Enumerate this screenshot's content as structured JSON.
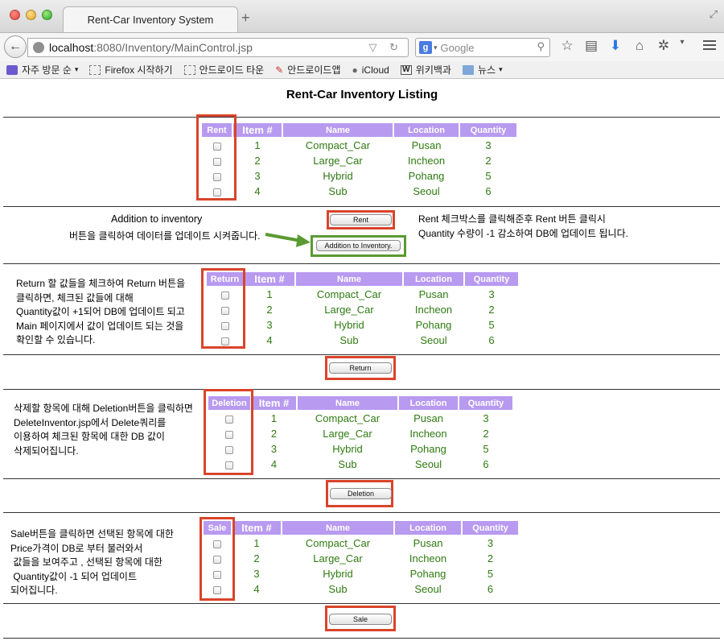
{
  "browser": {
    "tab_title": "Rent-Car Inventory System",
    "new_tab": "+",
    "url_host": "localhost",
    "url_path": ":8080/Inventory/MainControl.jsp",
    "search_placeholder": "Google",
    "search_engine_letter": "g",
    "bookmarks": [
      {
        "label": "자주 방문 순",
        "icon": "purple"
      },
      {
        "label": "Firefox 시작하기",
        "icon": "dashed"
      },
      {
        "label": "안드로이드 타운",
        "icon": "dashed"
      },
      {
        "label": "안드로이드앱",
        "icon": "pin"
      },
      {
        "label": "iCloud",
        "icon": "apple"
      },
      {
        "label": "위키백과",
        "icon": "w"
      },
      {
        "label": "뉴스",
        "icon": "folder"
      }
    ]
  },
  "page": {
    "title": "Rent-Car Inventory Listing",
    "columns": {
      "item": "Item #",
      "name": "Name",
      "location": "Location",
      "quantity": "Quantity"
    },
    "rows": [
      {
        "item": "1",
        "name": "Compact_Car",
        "location": "Pusan",
        "quantity": "3"
      },
      {
        "item": "2",
        "name": "Large_Car",
        "location": "Incheon",
        "quantity": "2"
      },
      {
        "item": "3",
        "name": "Hybrid",
        "location": "Pohang",
        "quantity": "5"
      },
      {
        "item": "4",
        "name": "Sub",
        "location": "Seoul",
        "quantity": "6"
      }
    ],
    "rent": {
      "header": "Rent",
      "button": "Rent",
      "addition_title": "Addition to inventory",
      "addition_desc": "버튼을 클릭하여 데이터를 업데이트 시켜줍니다.",
      "addition_button": "Addition to Inventory.",
      "note_lines": [
        "Rent 체크박스를 클릭해준후 Rent 버튼 클릭시",
        "Quantity 수량이 -1 감소하여 DB에 업데이트 됩니다."
      ]
    },
    "return": {
      "header": "Return",
      "button": "Return",
      "note_lines": [
        "Return 할 값들을 체크하여 Return 버튼을",
        "클릭하면, 체크된 값들에 대해",
        "Quantity값이 +1되어 DB에 업데이트 되고",
        "Main 페이지에서 값이 업데이트 되는 것을",
        "확인할 수 있습니다."
      ]
    },
    "deletion": {
      "header": "Deletion",
      "button": "Deletion",
      "note_lines": [
        "삭제할 항목에 대해 Deletion버튼을 클릭하면",
        "DeleteInventor.jsp에서 Delete쿼리를",
        "이용하여 체크된 항목에 대한 DB 값이",
        "삭제되어집니다."
      ]
    },
    "sale": {
      "header": "Sale",
      "button": "Sale",
      "note_lines": [
        "Sale버튼을 클릭하면 선택된 항목에 대한",
        "Price가격이 DB로 부터 불러와서",
        " 값들을 보여주고 , 선택된 항목에 대한",
        " Quantity값이 -1 되어 업데이트",
        "되어집니다."
      ]
    }
  }
}
